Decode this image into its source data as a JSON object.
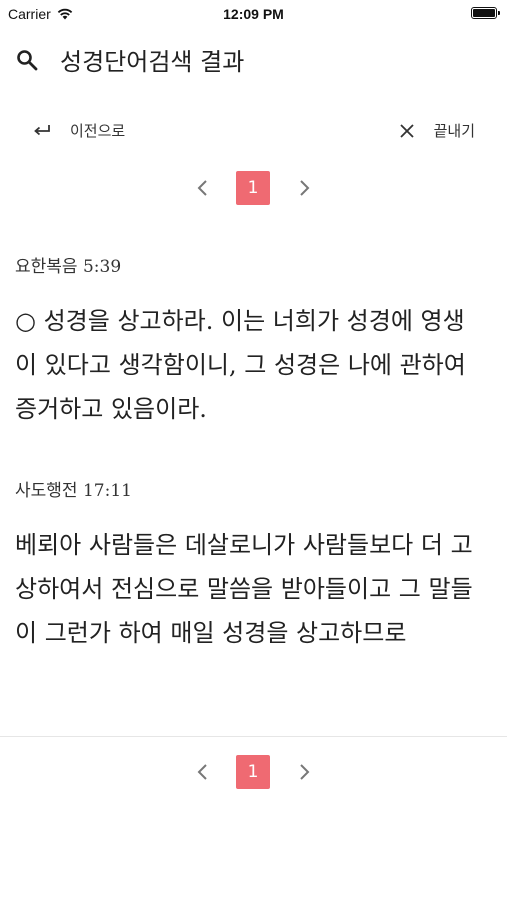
{
  "status_bar": {
    "carrier": "Carrier",
    "time": "12:09 PM"
  },
  "header": {
    "title": "성경단어검색 결과"
  },
  "nav": {
    "back_label": "이전으로",
    "close_label": "끝내기"
  },
  "pagination": {
    "current_page": "1"
  },
  "results": [
    {
      "reference": "요한복음 5:39",
      "text": "○ 성경을 상고하라. 이는 너희가 성경에 영생이 있다고 생각함이니, 그 성경은 나에 관하여 증거하고 있음이라."
    },
    {
      "reference": "사도행전 17:11",
      "text": "베뢰아 사람들은 데살로니가 사람들보다 더 고상하여서 전심으로 말씀을 받아들이고 그 말들이 그런가 하여 매일 성경을 상고하므로"
    }
  ],
  "icons": {
    "search": "search-icon",
    "back": "return-arrow-icon",
    "close": "close-icon",
    "prev": "chevron-left-icon",
    "next": "chevron-right-icon",
    "wifi": "wifi-icon",
    "battery": "battery-icon"
  },
  "colors": {
    "active_page": "#ef6a72"
  }
}
